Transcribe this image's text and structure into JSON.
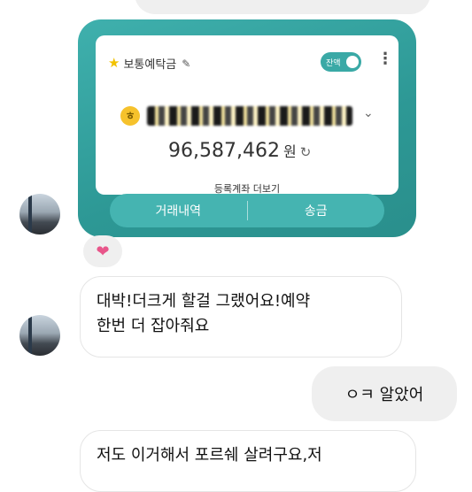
{
  "account_card": {
    "account_type": "보통예탁금",
    "balance_toggle_label": "잔액",
    "balance": "96,587,462",
    "currency_unit": "원",
    "more_accounts_label": "등록계좌 더보기",
    "history_button": "거래내역",
    "transfer_button": "송금"
  },
  "messages": {
    "reply_1_line_1": "대박!더크게 할걸 그랬어요!예약",
    "reply_1_line_2": "한번 더 잡아줘요",
    "my_reply": "ㅇㅋ 알았어",
    "reply_2_line_1": "저도 이거해서 포르쉐 살려구요,저"
  },
  "reaction": {
    "emoji": "heart-icon"
  },
  "colors": {
    "card_teal": "#2d9895",
    "heart": "#e8558a",
    "bubble_gray": "#efefef"
  }
}
